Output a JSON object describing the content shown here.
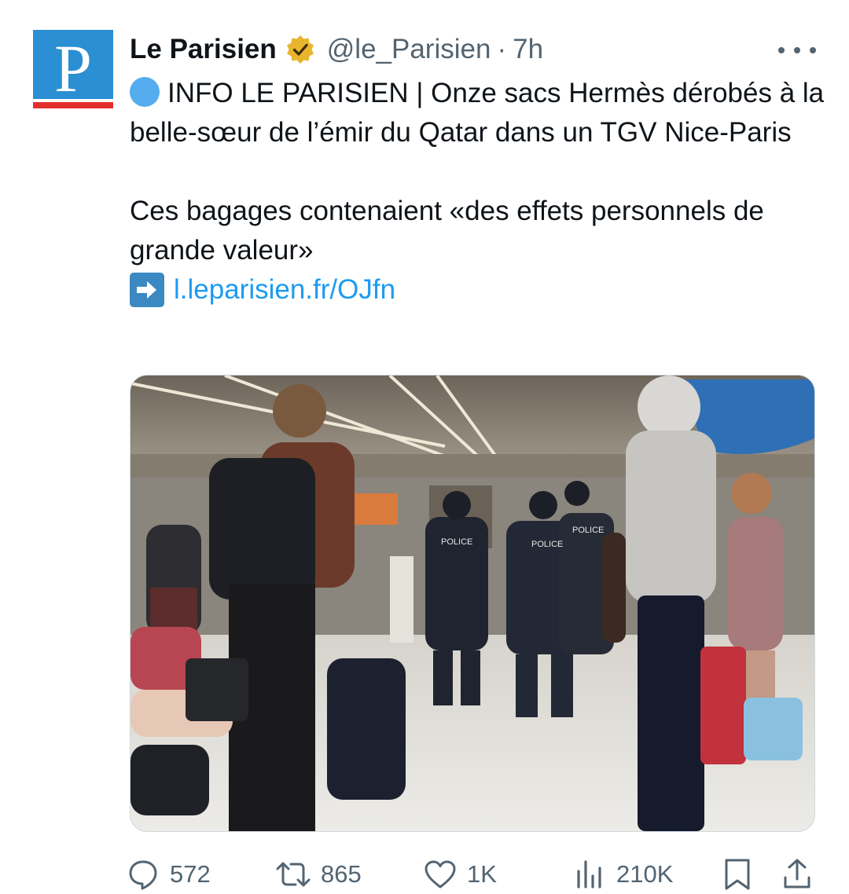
{
  "author": {
    "display_name": "Le Parisien",
    "handle": "@le_Parisien",
    "separator": "·",
    "time": "7h",
    "avatar_letter": "P",
    "verified_badge_icon": "gold-verified-badge-icon"
  },
  "tweet": {
    "headline": "INFO LE PARISIEN | Onze sacs Hermès dérobés à la belle-sœur de l’émir du Qatar dans un TGV Nice-Paris",
    "body": "Ces bagages contenaient «des effets personnels de grande valeur»",
    "link_text": "l.leparisien.fr/OJfn"
  },
  "media": {
    "signs": [
      "POLICE",
      "POLICE",
      "POLICE"
    ]
  },
  "actions": {
    "replies": "572",
    "retweets": "865",
    "likes": "1K",
    "views": "210K"
  },
  "colors": {
    "text": "#0f1419",
    "secondary": "#536471",
    "link": "#1d9bf0",
    "avatar_bg": "#2a8fd3",
    "avatar_stripe": "#e2302f"
  }
}
